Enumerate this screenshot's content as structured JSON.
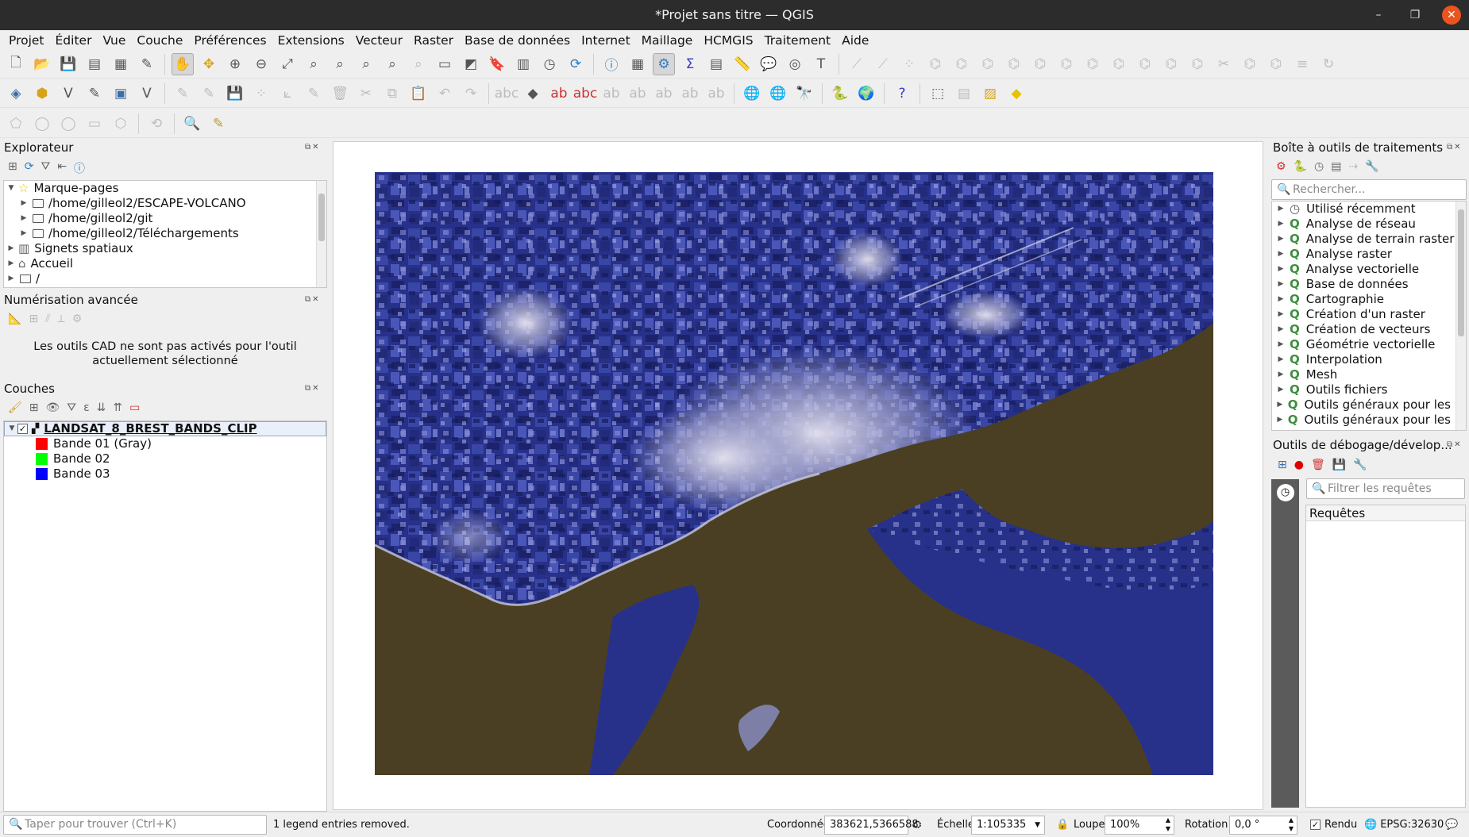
{
  "window": {
    "title": "*Projet sans titre — QGIS",
    "minimize": "–",
    "restore": "❐",
    "close": "✕"
  },
  "menu": [
    "Projet",
    "Éditer",
    "Vue",
    "Couche",
    "Préférences",
    "Extensions",
    "Vecteur",
    "Raster",
    "Base de données",
    "Internet",
    "Maillage",
    "HCMGIS",
    "Traitement",
    "Aide"
  ],
  "browser": {
    "title": "Explorateur",
    "items": [
      {
        "label": "Marque-pages",
        "icon": "star-icon"
      },
      {
        "label": "/home/gilleol2/ESCAPE-VOLCANO",
        "icon": "folder-icon"
      },
      {
        "label": "/home/gilleol2/git",
        "icon": "folder-icon"
      },
      {
        "label": "/home/gilleol2/Téléchargements",
        "icon": "folder-icon"
      },
      {
        "label": "Signets spatiaux",
        "icon": "bookmark-icon"
      },
      {
        "label": "Accueil",
        "icon": "home-icon"
      },
      {
        "label": "/",
        "icon": "folder-icon"
      }
    ]
  },
  "digitizing": {
    "title": "Numérisation avancée",
    "message": "Les outils CAD ne sont pas activés pour l'outil actuellement sélectionné"
  },
  "layers": {
    "title": "Couches",
    "layer_name": "LANDSAT_8_BREST_BANDS_CLIP",
    "bands": [
      {
        "label": "Bande 01 (Gray)",
        "color": "#ff0000"
      },
      {
        "label": "Bande 02",
        "color": "#00ff00"
      },
      {
        "label": "Bande 03",
        "color": "#0000ff"
      }
    ]
  },
  "processing": {
    "title": "Boîte à outils de traitements",
    "search_placeholder": "Rechercher...",
    "items": [
      "Utilisé récemment",
      "Analyse de réseau",
      "Analyse de terrain raster",
      "Analyse raster",
      "Analyse vectorielle",
      "Base de données",
      "Cartographie",
      "Création d'un raster",
      "Création de vecteurs",
      "Géométrie vectorielle",
      "Interpolation",
      "Mesh",
      "Outils fichiers",
      "Outils généraux pour les ...",
      "Outils généraux pour les ..."
    ]
  },
  "debug": {
    "title": "Outils de débogage/dévelop...",
    "filter_placeholder": "Filtrer les requêtes",
    "requests_header": "Requêtes"
  },
  "status": {
    "locator_placeholder": "Taper pour trouver (Ctrl+K)",
    "message": "1 legend entries removed.",
    "coord_label": "Coordonnée",
    "coord_value": "383621,5366588",
    "scale_label": "Échelle",
    "scale_value": "1:105335",
    "magnifier_label": "Loupe",
    "magnifier_value": "100%",
    "rotation_label": "Rotation",
    "rotation_value": "0,0 °",
    "render_label": "Rendu",
    "crs": "EPSG:32630"
  },
  "colors": {
    "titlebar": "#2c2c2c",
    "close_button": "#e95420",
    "water": "#4a3f22",
    "land": "#27318a"
  }
}
